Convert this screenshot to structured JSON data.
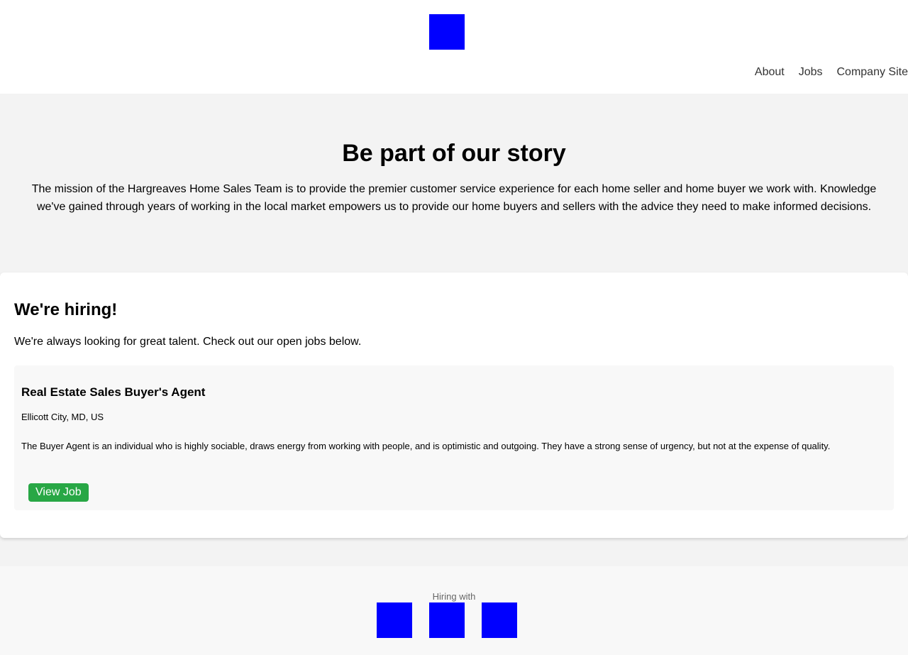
{
  "header": {
    "logo_icon": "company-logo",
    "logo_color": "#0000ff",
    "nav": [
      {
        "label": "About"
      },
      {
        "label": "Jobs"
      },
      {
        "label": "Company Site"
      }
    ]
  },
  "hero": {
    "title": "Be part of our story",
    "text": "The mission of the Hargreaves Home Sales Team is to provide the premier customer service experience for each home seller and home buyer we work with. Knowledge we've gained through years of working in the local market empowers us to provide our home buyers and sellers with the advice they need to make informed decisions."
  },
  "hiring": {
    "title": "We're hiring!",
    "intro": "We're always looking for great talent. Check out our open jobs below.",
    "jobs": [
      {
        "title": "Real Estate Sales Buyer's Agent",
        "location": "Ellicott City, MD, US",
        "description": "The Buyer Agent is an individual who is highly sociable, draws energy from working with people, and is optimistic and outgoing. They have a strong sense of urgency, but not at the expense of quality.",
        "button_label": "View Job"
      }
    ]
  },
  "footer": {
    "label": "Hiring with",
    "logo_icons": [
      "partner-logo-1",
      "partner-logo-2",
      "partner-logo-3"
    ]
  },
  "colors": {
    "accent_button": "#28a745",
    "hero_background": "#f3f3f3",
    "footer_background": "#f8f8f8"
  }
}
